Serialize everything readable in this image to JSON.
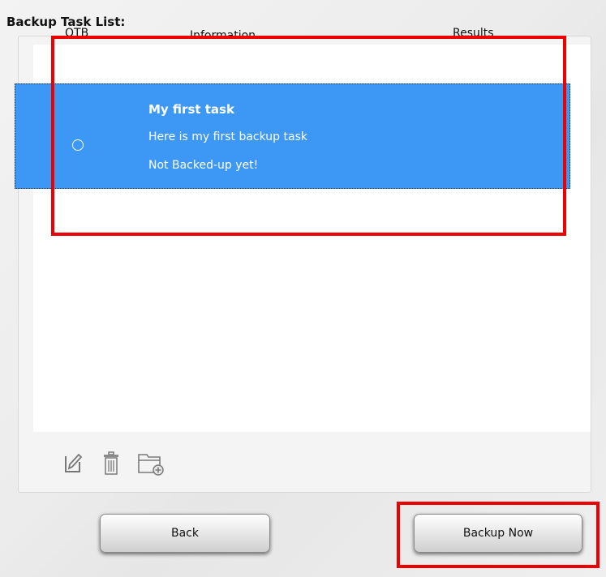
{
  "page": {
    "title": "Backup Task List:"
  },
  "table": {
    "columns": {
      "otb": "OTB",
      "information": "Information",
      "results": "Results"
    },
    "rows": [
      {
        "selected": true,
        "name": "My first task",
        "description": "Here is my first backup task",
        "status": "Not Backed-up yet!"
      }
    ]
  },
  "toolbar": {
    "icons": [
      "edit-icon",
      "trash-icon",
      "add-folder-icon"
    ]
  },
  "buttons": {
    "back": "Back",
    "backup_now": "Backup Now"
  },
  "colors": {
    "selection": "#3d97f5",
    "highlight": "#ee0000"
  }
}
